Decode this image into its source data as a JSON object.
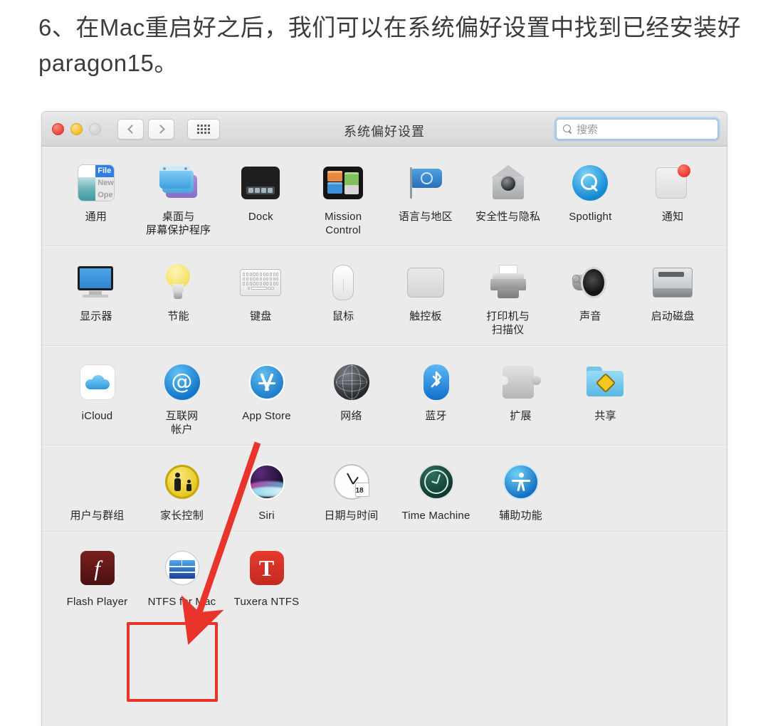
{
  "caption": "6、在Mac重启好之后，我们可以在系统偏好设置中找到已经安装好paragon15。",
  "window": {
    "title": "系统偏好设置",
    "search": {
      "placeholder": "搜索",
      "value": "",
      "icon": "search-icon"
    },
    "traffic_lights": [
      {
        "name": "close-button",
        "color": "#e8453c"
      },
      {
        "name": "minimize-button",
        "color": "#f0bd2a"
      },
      {
        "name": "zoom-button",
        "color": "#d3d3d3"
      }
    ],
    "nav": {
      "back_icon": "chevron-left-icon",
      "forward_icon": "chevron-right-icon",
      "grid_icon": "grid-view-icon"
    }
  },
  "rows": [
    {
      "items": [
        {
          "label": "通用",
          "icon": "general-icon",
          "menu_words": [
            "File",
            "New",
            "Open"
          ]
        },
        {
          "label": "桌面与\n屏幕保护程序",
          "icon": "desktop-screensaver-icon"
        },
        {
          "label": "Dock",
          "icon": "dock-icon"
        },
        {
          "label": "Mission\nControl",
          "icon": "mission-control-icon"
        },
        {
          "label": "语言与地区",
          "icon": "language-region-icon"
        },
        {
          "label": "安全性与隐私",
          "icon": "security-privacy-icon"
        },
        {
          "label": "Spotlight",
          "icon": "spotlight-icon"
        },
        {
          "label": "通知",
          "icon": "notifications-icon"
        }
      ]
    },
    {
      "items": [
        {
          "label": "显示器",
          "icon": "displays-icon"
        },
        {
          "label": "节能",
          "icon": "energy-saver-icon"
        },
        {
          "label": "键盘",
          "icon": "keyboard-icon"
        },
        {
          "label": "鼠标",
          "icon": "mouse-icon"
        },
        {
          "label": "触控板",
          "icon": "trackpad-icon"
        },
        {
          "label": "打印机与\n扫描仪",
          "icon": "printers-scanners-icon"
        },
        {
          "label": "声音",
          "icon": "sound-icon"
        },
        {
          "label": "启动磁盘",
          "icon": "startup-disk-icon"
        }
      ]
    },
    {
      "items": [
        {
          "label": "iCloud",
          "icon": "icloud-icon"
        },
        {
          "label": "互联网\n帐户",
          "icon": "internet-accounts-icon"
        },
        {
          "label": "App Store",
          "icon": "app-store-icon"
        },
        {
          "label": "网络",
          "icon": "network-icon"
        },
        {
          "label": "蓝牙",
          "icon": "bluetooth-icon"
        },
        {
          "label": "扩展",
          "icon": "extensions-icon"
        },
        {
          "label": "共享",
          "icon": "sharing-icon"
        }
      ]
    },
    {
      "items": [
        {
          "label": "用户与群组",
          "icon": "users-groups-icon"
        },
        {
          "label": "家长控制",
          "icon": "parental-controls-icon"
        },
        {
          "label": "Siri",
          "icon": "siri-icon"
        },
        {
          "label": "日期与时间",
          "icon": "date-time-icon",
          "calendar_day": "18"
        },
        {
          "label": "Time Machine",
          "icon": "time-machine-icon"
        },
        {
          "label": "辅助功能",
          "icon": "accessibility-icon"
        }
      ]
    },
    {
      "items": [
        {
          "label": "Flash Player",
          "icon": "flash-player-icon",
          "glyph": "f"
        },
        {
          "label": "NTFS for Mac",
          "icon": "ntfs-for-mac-icon",
          "highlighted": true
        },
        {
          "label": "Tuxera NTFS",
          "icon": "tuxera-ntfs-icon",
          "glyph": "T"
        }
      ]
    }
  ],
  "annotation": {
    "highlight_color": "#e8342a",
    "arrow_color": "#e8342a",
    "arrow_from": "app-store-icon",
    "arrow_to": "ntfs-for-mac-icon"
  }
}
